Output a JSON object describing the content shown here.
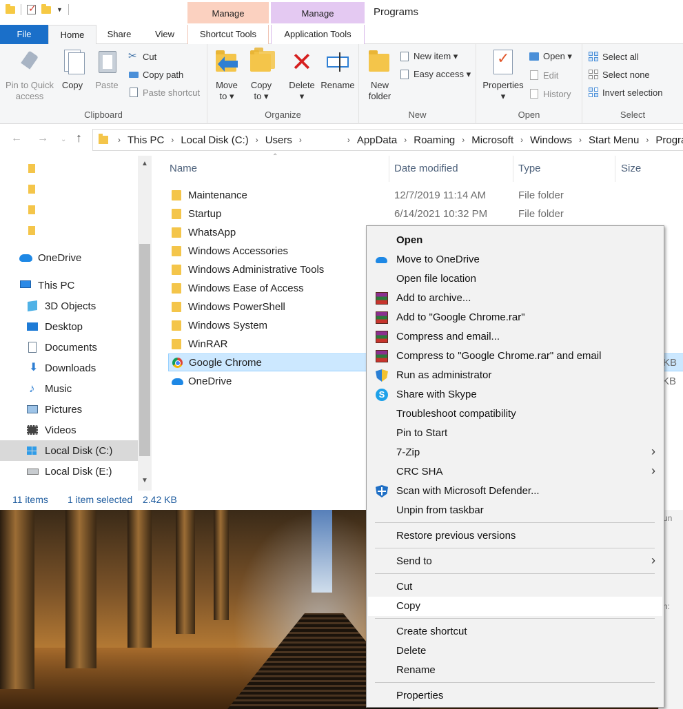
{
  "window": {
    "title": "Programs",
    "context_tabs": [
      {
        "group": "Manage",
        "tab": "Shortcut Tools",
        "color": "#fbd1c0"
      },
      {
        "group": "Manage",
        "tab": "Application Tools",
        "color": "#e4c9f2"
      }
    ]
  },
  "ribbon_tabs": [
    "File",
    "Home",
    "Share",
    "View"
  ],
  "ribbon": {
    "clipboard": {
      "label": "Clipboard",
      "pin_line1": "Pin to Quick",
      "pin_line2": "access",
      "copy": "Copy",
      "paste": "Paste",
      "cut": "Cut",
      "copy_path": "Copy path",
      "paste_shortcut": "Paste shortcut"
    },
    "organize": {
      "label": "Organize",
      "move_to_1": "Move",
      "move_to_2": "to ▾",
      "copy_to_1": "Copy",
      "copy_to_2": "to ▾",
      "delete_1": "Delete",
      "delete_2": "▾",
      "rename": "Rename"
    },
    "new": {
      "label": "New",
      "new_folder_1": "New",
      "new_folder_2": "folder",
      "new_item": "New item ▾",
      "easy_access": "Easy access ▾"
    },
    "open": {
      "label": "Open",
      "properties": "Properties",
      "properties_dd": "▾",
      "open": "Open ▾",
      "edit": "Edit",
      "history": "History"
    },
    "select": {
      "label": "Select",
      "select_all": "Select all",
      "select_none": "Select none",
      "invert_selection": "Invert selection"
    }
  },
  "address": {
    "crumbs": [
      "This PC",
      "Local Disk (C:)",
      "Users",
      "",
      "AppData",
      "Roaming",
      "Microsoft",
      "Windows",
      "Start Menu",
      "Progra"
    ]
  },
  "nav": {
    "items": [
      {
        "label": "",
        "icon": "folder-icon"
      },
      {
        "label": "",
        "icon": "folder-icon"
      },
      {
        "label": "",
        "icon": "folder-icon"
      },
      {
        "label": "",
        "icon": "folder-icon"
      },
      {
        "label": "OneDrive",
        "icon": "onedrive-icon"
      },
      {
        "label": "This PC",
        "icon": "this-pc-icon"
      },
      {
        "label": "3D Objects",
        "icon": "3d-objects-icon"
      },
      {
        "label": "Desktop",
        "icon": "desktop-icon"
      },
      {
        "label": "Documents",
        "icon": "documents-icon"
      },
      {
        "label": "Downloads",
        "icon": "downloads-icon"
      },
      {
        "label": "Music",
        "icon": "music-icon"
      },
      {
        "label": "Pictures",
        "icon": "pictures-icon"
      },
      {
        "label": "Videos",
        "icon": "videos-icon"
      },
      {
        "label": "Local Disk (C:)",
        "icon": "windows-drive-icon"
      },
      {
        "label": "Local Disk (E:)",
        "icon": "drive-icon"
      }
    ]
  },
  "columns": {
    "name": "Name",
    "date": "Date modified",
    "type": "Type",
    "size": "Size"
  },
  "files": [
    {
      "name": "Maintenance",
      "date": "12/7/2019 11:14 AM",
      "type": "File folder",
      "size": "",
      "icon": "folder-icon"
    },
    {
      "name": "Startup",
      "date": "6/14/2021 10:32 PM",
      "type": "File folder",
      "size": "",
      "icon": "folder-icon"
    },
    {
      "name": "WhatsApp",
      "date": "",
      "type": "",
      "size": "",
      "icon": "folder-icon"
    },
    {
      "name": "Windows Accessories",
      "date": "",
      "type": "",
      "size": "",
      "icon": "folder-icon"
    },
    {
      "name": "Windows Administrative Tools",
      "date": "",
      "type": "",
      "size": "",
      "icon": "folder-icon"
    },
    {
      "name": "Windows Ease of Access",
      "date": "",
      "type": "",
      "size": "",
      "icon": "folder-icon"
    },
    {
      "name": "Windows PowerShell",
      "date": "",
      "type": "",
      "size": "",
      "icon": "folder-icon"
    },
    {
      "name": "Windows System",
      "date": "",
      "type": "",
      "size": "",
      "icon": "folder-icon"
    },
    {
      "name": "WinRAR",
      "date": "",
      "type": "",
      "size": "",
      "icon": "folder-icon"
    },
    {
      "name": "Google Chrome",
      "date": "",
      "type": "",
      "size": "KB",
      "icon": "chrome-icon"
    },
    {
      "name": "OneDrive",
      "date": "",
      "type": "",
      "size": "KB",
      "icon": "onedrive-icon"
    }
  ],
  "status": {
    "items": "11 items",
    "selected": "1 item selected",
    "size": "2.42 KB"
  },
  "behind_window": {
    "frag1": "un",
    "frag2": "n:"
  },
  "context_menu": {
    "items": [
      {
        "label": "Open",
        "bold": true,
        "icon": ""
      },
      {
        "label": "Move to OneDrive",
        "icon": "onedrive-icon"
      },
      {
        "label": "Open file location",
        "icon": ""
      },
      {
        "label": "Add to archive...",
        "icon": "winrar-icon"
      },
      {
        "label": "Add to \"Google Chrome.rar\"",
        "icon": "winrar-icon"
      },
      {
        "label": "Compress and email...",
        "icon": "winrar-icon"
      },
      {
        "label": "Compress to \"Google Chrome.rar\" and email",
        "icon": "winrar-icon"
      },
      {
        "label": "Run as administrator",
        "icon": "uac-shield-icon"
      },
      {
        "label": "Share with Skype",
        "icon": "skype-icon"
      },
      {
        "label": "Troubleshoot compatibility",
        "icon": ""
      },
      {
        "label": "Pin to Start",
        "icon": ""
      },
      {
        "label": "7-Zip",
        "icon": "",
        "submenu": true
      },
      {
        "label": "CRC SHA",
        "icon": "",
        "submenu": true
      },
      {
        "label": "Scan with Microsoft Defender...",
        "icon": "defender-icon"
      },
      {
        "label": "Unpin from taskbar",
        "icon": ""
      },
      {
        "label": "Restore previous versions",
        "icon": ""
      },
      {
        "label": "Send to",
        "icon": "",
        "submenu": true
      },
      {
        "label": "Cut",
        "icon": ""
      },
      {
        "label": "Copy",
        "icon": "",
        "hover": true
      },
      {
        "label": "Create shortcut",
        "icon": ""
      },
      {
        "label": "Delete",
        "icon": ""
      },
      {
        "label": "Rename",
        "icon": ""
      },
      {
        "label": "Properties",
        "icon": ""
      }
    ],
    "submenu_glyph": "›"
  },
  "colors": {
    "accent": "#1a6fc9",
    "selection": "#cce8ff",
    "status_text": "#1d5b9e"
  }
}
